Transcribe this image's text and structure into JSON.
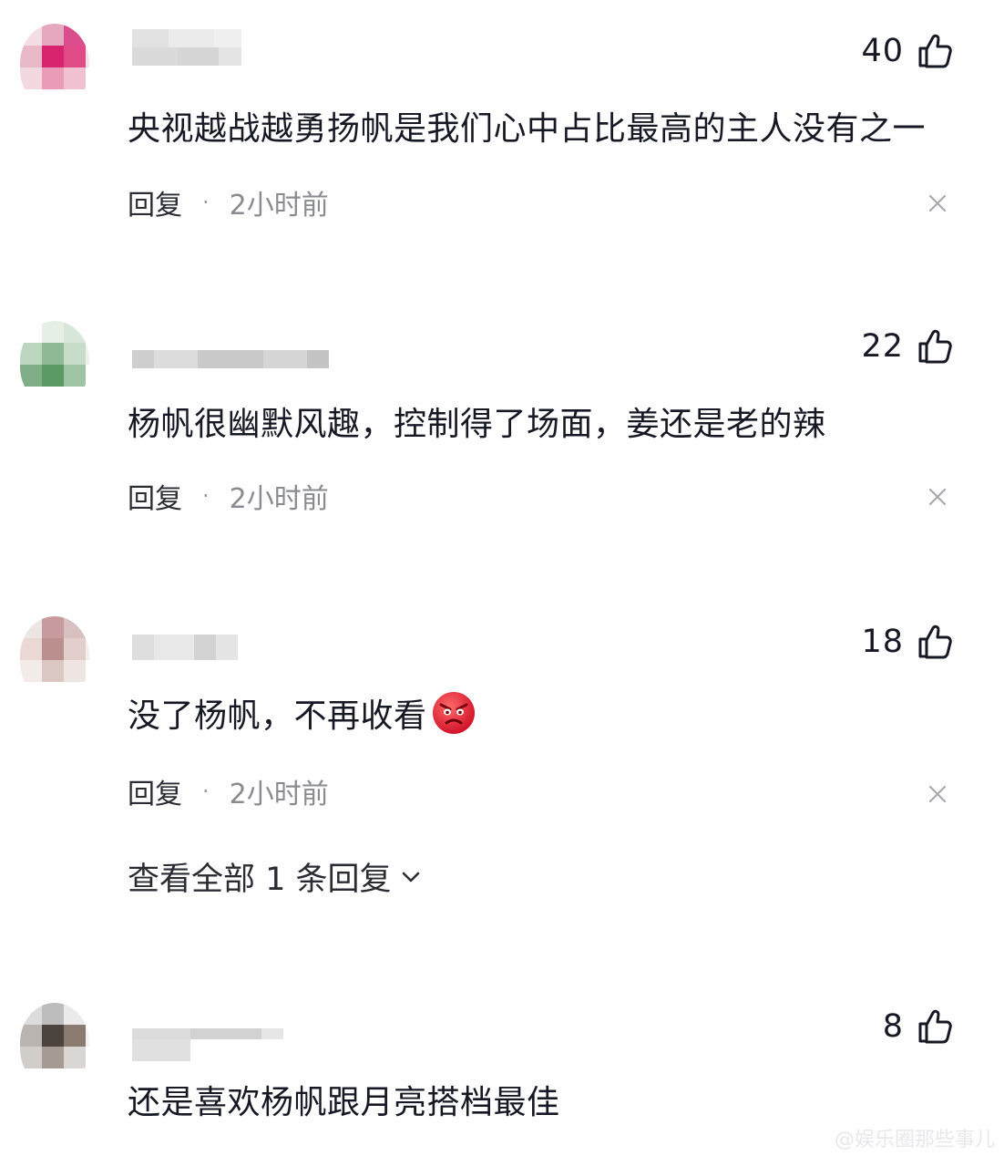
{
  "comments": [
    {
      "likes": "40",
      "text": "央视越战越勇扬帆是我们心中占比最高的主人没有之一",
      "reply_label": "回复",
      "separator": "·",
      "time": "2小时前",
      "avatar_colors": [
        "#f4dde4",
        "#e6a8bf",
        "#d94d8c",
        "#f2c9d6",
        "#e8b9c7",
        "#d8236f",
        "#e04a87",
        "#f5e2e8",
        "#f3d8e0",
        "#ea9bb8",
        "#f0c1d1",
        "#ffffff"
      ]
    },
    {
      "likes": "22",
      "text": "杨帆很幽默风趣，控制得了场面，姜还是老的辣",
      "reply_label": "回复",
      "separator": "·",
      "time": "2小时前",
      "avatar_colors": [
        "#ffffff",
        "#e5efe6",
        "#d7e6d9",
        "#dbe7dc",
        "#bcd6bf",
        "#8fb995",
        "#c7ddc9",
        "#eaf2eb",
        "#7fae86",
        "#5b9a63",
        "#9fc4a4",
        "#ffffff"
      ]
    },
    {
      "likes": "18",
      "text": "没了杨帆，不再收看",
      "reply_label": "回复",
      "separator": "·",
      "time": "2小时前",
      "avatar_colors": [
        "#ede4e4",
        "#c79b9d",
        "#d8c0c0",
        "#ffffff",
        "#e9d8d4",
        "#bc8f8f",
        "#e2cfcd",
        "#f4eeee",
        "#f3ebe8",
        "#dcc8c3",
        "#eee4e1",
        "#ffffff"
      ],
      "view_replies": "查看全部 1 条回复"
    },
    {
      "likes": "8",
      "text": "还是喜欢杨帆跟月亮搭档最佳",
      "avatar_colors": [
        "#dcdcdc",
        "#bdbdbd",
        "#eaeaea",
        "#ffffff",
        "#b9b4b0",
        "#4a433e",
        "#8a7a70",
        "#f1f1f1",
        "#d0cdca",
        "#a59b93",
        "#d9d6d3",
        "#ffffff"
      ]
    }
  ],
  "watermark": "@娱乐圈那些事儿",
  "colors": {
    "text": "#161823",
    "meta": "#8a8b91",
    "icon": "#161823"
  }
}
